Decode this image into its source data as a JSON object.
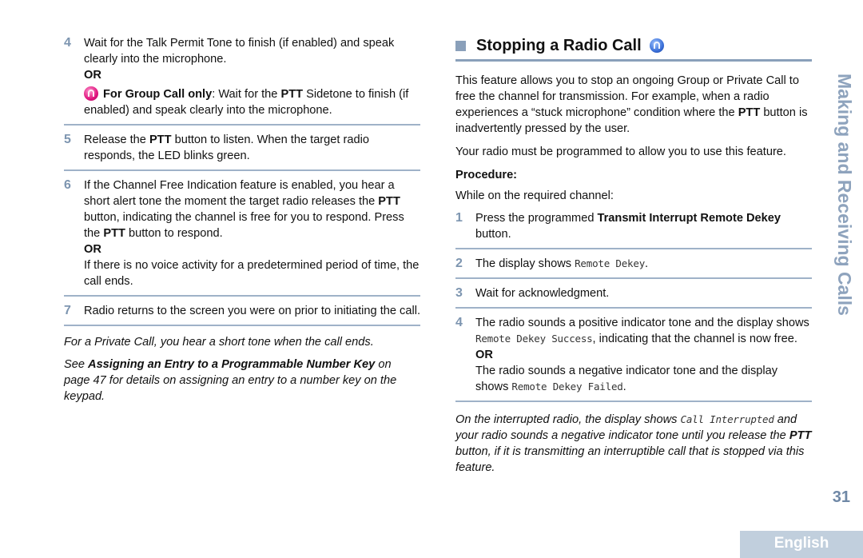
{
  "left_column": {
    "steps": [
      {
        "number": "4",
        "text": "Wait for the Talk Permit Tone to finish (if enabled) and speak clearly into the microphone.",
        "or": "OR",
        "alt_icon": "group-call-icon",
        "alt_bold": "For Group Call only",
        "alt_text_1": ": Wait for the ",
        "alt_bold_2": "PTT",
        "alt_text_2": " Sidetone to finish (if enabled) and speak clearly into the microphone."
      },
      {
        "number": "5",
        "text_1": "Release the ",
        "bold_1": "PTT",
        "text_2": " button to listen. When the target radio responds, the LED blinks green."
      },
      {
        "number": "6",
        "text_1": "If the Channel Free Indication feature is enabled, you hear a short alert tone the moment the target radio releases the ",
        "bold_1": "PTT",
        "text_2": " button, indicating the channel is free for you to respond. Press the ",
        "bold_2": "PTT",
        "text_3": " button to respond.",
        "or": "OR",
        "alt_text": "If there is no voice activity for a predetermined period of time, the call ends."
      },
      {
        "number": "7",
        "text": "Radio returns to the screen you were on prior to initiating the call."
      }
    ],
    "note_1": "For a Private Call, you hear a short tone when the call ends.",
    "note_2_pre": "See ",
    "note_2_bold": "Assigning an Entry to a Programmable Number Key",
    "note_2_post": " on page 47 for details on assigning an entry to a number key on the keypad."
  },
  "right_column": {
    "heading": "Stopping a Radio Call",
    "heading_icon": "digital-mode-icon",
    "intro_1": "This feature allows you to stop an ongoing Group or Private Call to free the channel for transmission. For example, when a radio experiences a “stuck microphone” condition where the ",
    "intro_bold": "PTT",
    "intro_2": " button is inadvertently pressed by the user.",
    "intro_para2": "Your radio must be programmed to allow you to use this feature.",
    "procedure_label": "Procedure:",
    "procedure_intro": "While on the required channel:",
    "steps": [
      {
        "number": "1",
        "text_1": "Press the programmed ",
        "bold_1": "Transmit Interrupt Remote Dekey",
        "text_2": " button."
      },
      {
        "number": "2",
        "text_1": "The display shows ",
        "mono_1": "Remote Dekey",
        "text_2": "."
      },
      {
        "number": "3",
        "text": "Wait for acknowledgment."
      },
      {
        "number": "4",
        "text_1": "The radio sounds a positive indicator tone and the display shows ",
        "mono_1": "Remote Dekey Success",
        "text_2": ", indicating that the channel is now free.",
        "or": "OR",
        "alt_text_1": "The radio sounds a negative indicator tone and the display shows ",
        "alt_mono": "Remote Dekey Failed",
        "alt_text_2": "."
      }
    ],
    "note_pre": "On the interrupted radio, the display shows ",
    "note_mono": "Call Interrupted",
    "note_mid": " and your radio sounds a negative indicator tone until you release the ",
    "note_bold": "PTT",
    "note_post": " button, if it is transmitting an interruptible call that is stopped via this feature."
  },
  "side_tab": "Making and Receiving Calls",
  "page_number": "31",
  "language_tab": "English"
}
